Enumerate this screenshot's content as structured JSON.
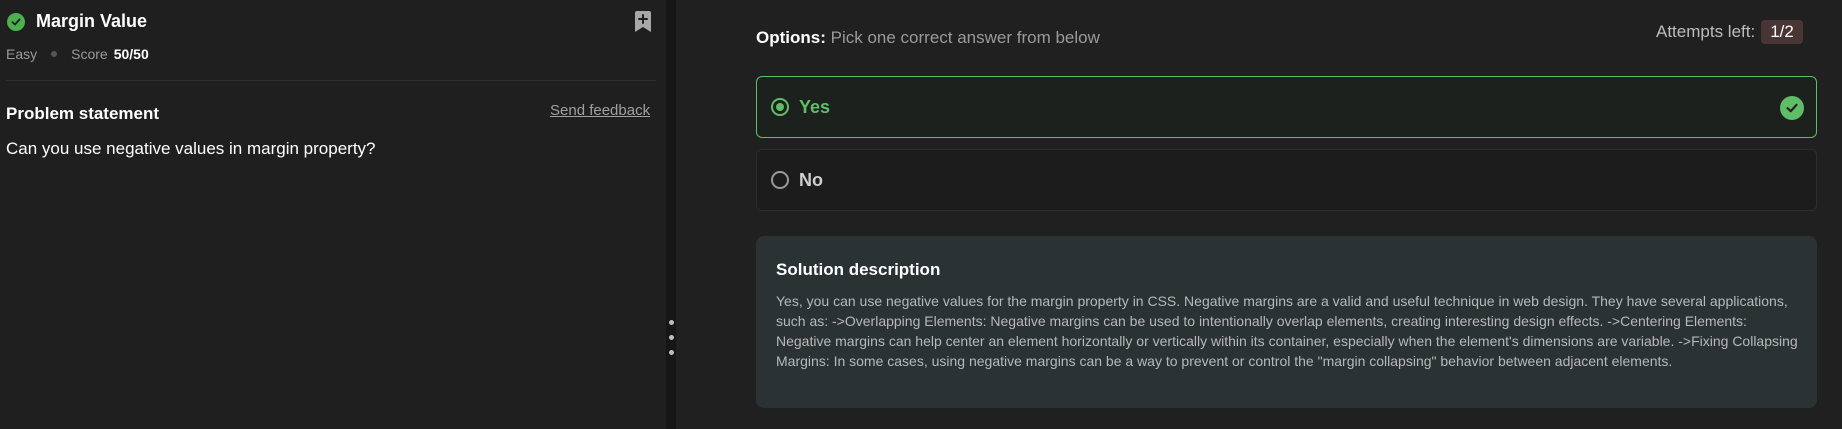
{
  "problem": {
    "title": "Margin Value",
    "difficulty": "Easy",
    "score_label": "Score",
    "score_value": "50/50",
    "statement_heading": "Problem statement",
    "feedback_link": "Send feedback",
    "question": "Can you use negative values in margin property?"
  },
  "options_panel": {
    "options_label": "Options:",
    "options_instruction": "Pick one correct answer from below",
    "attempts_label": "Attempts left:",
    "attempts_value": "1/2",
    "choices": [
      {
        "label": "Yes",
        "state": "correct-selected"
      },
      {
        "label": "No",
        "state": "unselected"
      }
    ]
  },
  "solution": {
    "heading": "Solution description",
    "text": "Yes, you can use negative values for the margin property in CSS. Negative margins are a valid and useful technique in web design. They have several applications, such as: ->Overlapping Elements: Negative margins can be used to intentionally overlap elements, creating interesting design effects. ->Centering Elements: Negative margins can help center an element horizontally or vertically within its container, especially when the element's dimensions are variable. ->Fixing Collapsing Margins: In some cases, using negative margins can be a way to prevent or control the \"margin collapsing\" behavior between adjacent elements."
  },
  "colors": {
    "success": "#5fbd67",
    "background": "#1e1e1e",
    "solution_bg": "#2b3233",
    "attempts_badge_bg": "#4a3535"
  },
  "icons": {
    "solved": "check-circle-icon",
    "bookmark": "bookmark-add-icon",
    "correct": "check-circle-icon",
    "splitter": "vertical-dots-icon"
  }
}
